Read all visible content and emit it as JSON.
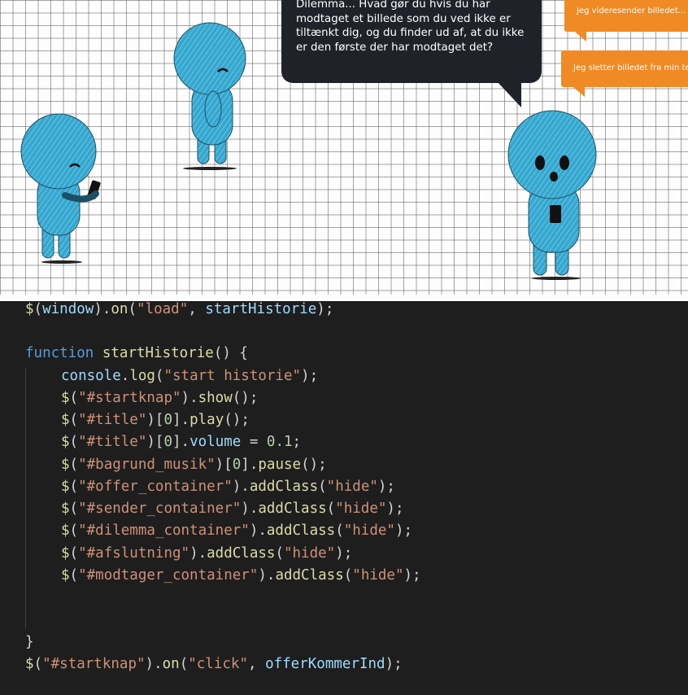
{
  "scene": {
    "dialog_text": "Dilemma... Hvad gør du hvis du har modtaget et billede som du ved ikke er tiltænkt dig, og du finder ud af, at du ikke er den første der har modtaget det?",
    "choice_1": "Jeg videresender billedet...",
    "choice_2": "Jeg sletter billedet fra min telefon",
    "colors": {
      "figure": "#35a7cf",
      "bubble": "#1f2329",
      "choice": "#f08a24"
    }
  },
  "code": {
    "l1": {
      "a": "$",
      "b": "(",
      "c": "window",
      "d": ").",
      "e": "on",
      "f": "(",
      "g": "\"load\"",
      "h": ", ",
      "i": "startHistorie",
      "j": ");"
    },
    "l2": {
      "a": "function",
      "b": " ",
      "c": "startHistorie",
      "d": "() {"
    },
    "l3": {
      "a": "console",
      "b": ".",
      "c": "log",
      "d": "(",
      "e": "\"start historie\"",
      "f": ");"
    },
    "l4": {
      "a": "$",
      "b": "(",
      "c": "\"#startknap\"",
      "d": ").",
      "e": "show",
      "f": "();"
    },
    "l5": {
      "a": "$",
      "b": "(",
      "c": "\"#title\"",
      "d": ")[",
      "e": "0",
      "f": "].",
      "g": "play",
      "h": "();"
    },
    "l6": {
      "a": "$",
      "b": "(",
      "c": "\"#title\"",
      "d": ")[",
      "e": "0",
      "f": "].",
      "g": "volume",
      "h": " = ",
      "i": "0.1",
      "j": ";"
    },
    "l7": {
      "a": "$",
      "b": "(",
      "c": "\"#bagrund_musik\"",
      "d": ")[",
      "e": "0",
      "f": "].",
      "g": "pause",
      "h": "();"
    },
    "l8": {
      "a": "$",
      "b": "(",
      "c": "\"#offer_container\"",
      "d": ").",
      "e": "addClass",
      "f": "(",
      "g": "\"hide\"",
      "h": ");"
    },
    "l9": {
      "a": "$",
      "b": "(",
      "c": "\"#sender_container\"",
      "d": ").",
      "e": "addClass",
      "f": "(",
      "g": "\"hide\"",
      "h": ");"
    },
    "l10": {
      "a": "$",
      "b": "(",
      "c": "\"#dilemma_container\"",
      "d": ").",
      "e": "addClass",
      "f": "(",
      "g": "\"hide\"",
      "h": ");"
    },
    "l11": {
      "a": "$",
      "b": "(",
      "c": "\"#afslutning\"",
      "d": ").",
      "e": "addClass",
      "f": "(",
      "g": "\"hide\"",
      "h": ");"
    },
    "l12": {
      "a": "$",
      "b": "(",
      "c": "\"#modtager_container\"",
      "d": ").",
      "e": "addClass",
      "f": "(",
      "g": "\"hide\"",
      "h": ");"
    },
    "l13": {
      "a": "}"
    },
    "l14": {
      "a": "$",
      "b": "(",
      "c": "\"#startknap\"",
      "d": ").",
      "e": "on",
      "f": "(",
      "g": "\"click\"",
      "h": ", ",
      "i": "offerKommerInd",
      "j": ");"
    }
  }
}
